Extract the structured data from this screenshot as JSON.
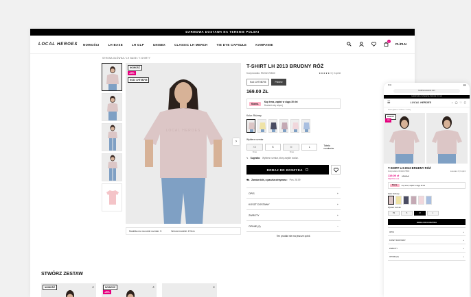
{
  "desktop": {
    "promo_bar": "DARMOWA DOSTAWA NA TERENIE POLSKI",
    "logo": "LOCAL HEROES",
    "menu": [
      "NOWOŚCI",
      "LH BASE",
      "LH GLP",
      "UNISEX",
      "CLASSIC LH MERCH",
      "TIE DYE CAPSULE",
      "KAMPANIE"
    ],
    "currency": "PL/PLN",
    "cart_count": "1",
    "breadcrumb": "STRONA GŁÓWNA / LH BASE / T-SHIRTY",
    "badges": {
      "new": "NOWOŚĆ",
      "discount": "-25%",
      "sku": "KOD: LHT0B705"
    },
    "image_caption": {
      "model_size": "Modelka ma na sobie rozmiar: S",
      "model_height": "Wzrost modelki: 170cm"
    },
    "product": {
      "title": "T-SHIRT LH 2013 BRUDNY RÓŻ",
      "code": "Kod produktu: RK2321735D0",
      "rating": "★★★★★",
      "reviews": "0 | 0 opinii",
      "chips": [
        "Kod: LHT0B705",
        "Pobierz"
      ],
      "price": "169.00 ZŁ",
      "klarna_logo": "Klarna.",
      "klarna_line1": "Kup teraz, zapłać w ciągu 30 dni",
      "klarna_line2": "Dowiedz się więcej",
      "color_label": "Kolor: Różowy",
      "size_label": "Wybierz rozmiar",
      "sizes": [
        "XS",
        "S",
        "M",
        "L"
      ],
      "size_sub": [
        "Brak",
        "",
        "Brak",
        ""
      ],
      "size_chart": "Tabela rozmiarów",
      "size_hint_bold": "Sugestia:",
      "size_hint": "Wybierz rozmiar, który zwykle nosisz.",
      "add_to_cart": "DODAJ DO KOSZYKA",
      "shipping_bold": "Zamów dziś, a paczka otrzymasz:",
      "shipping_date": "Pon. 28.09",
      "accordion": [
        {
          "label": "OPIS",
          "sign": "+"
        },
        {
          "label": "KOSZT DOSTAWY",
          "sign": "+"
        },
        {
          "label": "ZWROTY",
          "sign": "+"
        },
        {
          "label": "OPINIE (0)",
          "sign": "−"
        }
      ],
      "no_reviews": "Ten produkt nie ma jeszcze opinii."
    },
    "combo_title": "STWÓRZ ZESTAW",
    "combo_badges": [
      "NOWOŚĆ",
      "NOWOŚĆ",
      "-25%"
    ]
  },
  "mobile": {
    "time": "9:41",
    "url": "localheroesstore.com",
    "promo_bar": "DARMOWA DOSTAWA NA TERENIE POLSKI",
    "logo": "LOCAL HEROES",
    "breadcrumb": "Strona główna / LH Base / T-shirty",
    "title": "T-SHIRT LH 2013 BRUDNY RÓŻ",
    "code": "Kod produktu: RK2321735D0",
    "rating": "★★★★★ 0 | 0 opinii",
    "price": "119,00 zł",
    "old_price": "159,00 zł",
    "note": "Najniższa cena",
    "klarna": "Klarna.",
    "klarna_text": "Kup teraz, zapłać w ciągu 30 dni",
    "color_label": "Kolor: Różowy",
    "size_label": "Wybierz rozmiar",
    "sizes": [
      "XS",
      "S",
      "M",
      "L"
    ],
    "add_to_cart": "DODAJ DO KOSZYKA",
    "accordion": [
      "OPIS",
      "KOSZT DOSTAWY",
      "ZWROTY",
      "OPINIE (0)"
    ]
  },
  "colors": {
    "accent_pink": "#e5007e",
    "shirt_pink": "#dcc6c6"
  }
}
